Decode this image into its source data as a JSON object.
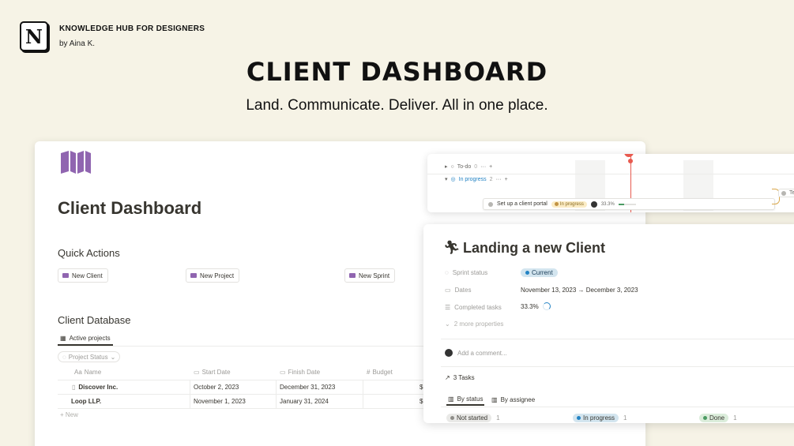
{
  "brand": {
    "logo_letter": "N",
    "title": "KNOWLEDGE HUB FOR DESIGNERS",
    "author": "by Aina K."
  },
  "hero": {
    "title": "CLIENT DASHBOARD",
    "subtitle": "Land. Communicate. Deliver. All in one place."
  },
  "page": {
    "icon": "book-open-icon",
    "title": "Client Dashboard",
    "quick_actions": {
      "heading": "Quick Actions",
      "buttons": [
        "New Client",
        "New Project",
        "New Sprint"
      ]
    },
    "database": {
      "heading": "Client Database",
      "active_tab": "Active projects",
      "filter": "Project Status",
      "columns": [
        "Name",
        "Start Date",
        "Finish Date",
        "Budget"
      ],
      "rows": [
        {
          "name": "Discover Inc.",
          "start": "October 2, 2023",
          "finish": "December 31, 2023",
          "budget": "$"
        },
        {
          "name": "Loop LLP.",
          "start": "November 1, 2023",
          "finish": "January 31, 2024",
          "budget": "$"
        }
      ],
      "new_label": "New"
    }
  },
  "timeline": {
    "groups": [
      {
        "label": "To-do",
        "count": "0",
        "more": "···",
        "add": "+"
      },
      {
        "label": "In progress",
        "count": "2",
        "more": "···",
        "add": "+"
      }
    ],
    "item": {
      "name": "Set up a client portal",
      "status": "In progress",
      "progress": "33.3%"
    },
    "edge_label": "Te"
  },
  "detail": {
    "icon": "running-person-icon",
    "title": "Landing a new Client",
    "properties": [
      {
        "label": "Sprint status",
        "value": "Current"
      },
      {
        "label": "Dates",
        "value": "November 13, 2023 → December 3, 2023"
      },
      {
        "label": "Completed tasks",
        "value": "33.3%"
      }
    ],
    "more_properties": "2 more properties",
    "comment_placeholder": "Add a comment...",
    "tasks_label": "3 Tasks",
    "tabs": [
      "By status",
      "By assignee"
    ],
    "groups": [
      {
        "label": "Not started",
        "count": "1"
      },
      {
        "label": "In progress",
        "count": "1"
      },
      {
        "label": "Done",
        "count": "1"
      }
    ]
  },
  "colors": {
    "background": "#f6f3e6",
    "accent_purple": "#9065b0",
    "today_red": "#e85a4f",
    "blue": "#2383c4"
  }
}
